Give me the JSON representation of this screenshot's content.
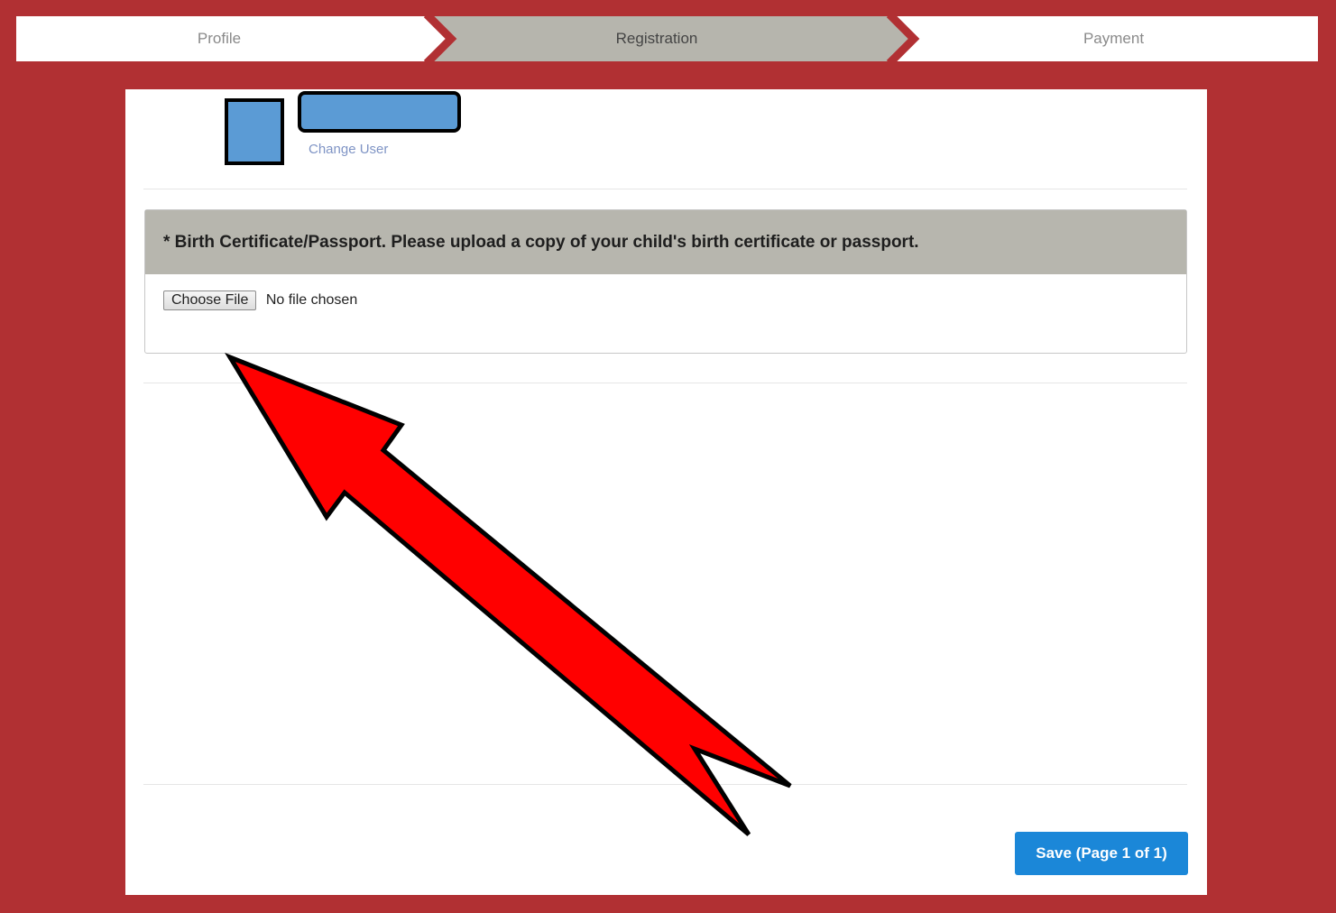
{
  "stepper": {
    "steps": [
      {
        "label": "Profile"
      },
      {
        "label": "Registration"
      },
      {
        "label": "Payment"
      }
    ],
    "active_index": 1
  },
  "user": {
    "change_user_label": "Change User"
  },
  "upload": {
    "prompt": "* Birth Certificate/Passport. Please upload a copy of your child's birth certificate or passport.",
    "choose_file_label": "Choose File",
    "no_file_text": "No file chosen"
  },
  "footer": {
    "save_label": "Save (Page 1 of 1)"
  },
  "colors": {
    "page_background": "#b13033",
    "active_step": "#b6b5ad",
    "header_background": "#b7b6ae",
    "accent_blue": "#1b87d8",
    "redaction_blue": "#5b9bd5",
    "annotation_red": "#ff0000"
  }
}
